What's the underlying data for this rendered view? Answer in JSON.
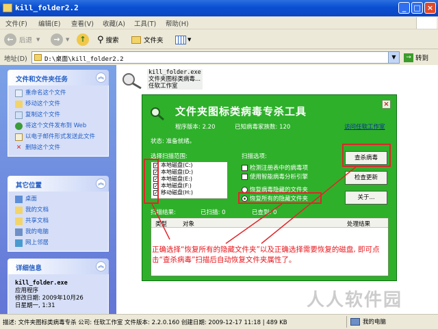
{
  "window": {
    "title": "kill_folder2.2"
  },
  "menu": [
    "文件(F)",
    "编辑(E)",
    "查看(V)",
    "收藏(A)",
    "工具(T)",
    "帮助(H)"
  ],
  "toolbar": {
    "back": "后退",
    "search": "搜索",
    "folders": "文件夹"
  },
  "address": {
    "label": "地址(D)",
    "path": "D:\\桌面\\kill_folder2.2",
    "go": "转到"
  },
  "tasks": {
    "title": "文件和文件夹任务",
    "items": [
      "重命名这个文件",
      "移动这个文件",
      "复制这个文件",
      "将这个文件发布到 Web",
      "以电子邮件形式发送此文件",
      "删除这个文件"
    ]
  },
  "places": {
    "title": "其它位置",
    "items": [
      "桌面",
      "我的文档",
      "共享文档",
      "我的电脑",
      "网上邻居"
    ]
  },
  "details": {
    "title": "详细信息",
    "name": "kill_folder.exe",
    "type": "应用程序",
    "modified_label": "修改日期: 2009年10月26",
    "modified_time": "日星期一, 1:31"
  },
  "file": {
    "name": "kill_folder.exe",
    "desc": "文件夹图标类病毒...",
    "company": "任软工作室"
  },
  "status": {
    "text": "描述: 文件夹图标类病毒专杀 公司: 任软工作室 文件版本: 2.2.0.160 创建日期: 2009-12-17 11:18 | 489 KB",
    "computer": "我的电脑"
  },
  "app": {
    "title": "文件夹图标类病毒专杀工具",
    "version": "程序版本: 2.20",
    "signatures": "已知病毒家族数: 120",
    "link": "访问任软工作室",
    "state": "状态: 准备就绪。",
    "scope_label": "选择扫描范围:",
    "drives": [
      "本地磁盘(C:)",
      "本地磁盘(D:)",
      "本地磁盘(E:)",
      "本地磁盘(F:)",
      "移动磁盘(H:)"
    ],
    "options_label": "扫描选项:",
    "opt1": "检测注册表中的病毒项",
    "opt2": "使用智能病毒分析引擎",
    "opt3": "恢复病毒隐藏的文件夹",
    "opt4": "恢复所有的隐藏文件夹",
    "btn_scan": "查杀病毒",
    "btn_update": "检查更新",
    "btn_about": "关于...",
    "scan_result": "扫描结果:",
    "scanned": "已扫描: 0",
    "detected": "已查到: 0",
    "col_type": "类型",
    "col_object": "对象",
    "col_result": "处理结果"
  },
  "annotation": "正确选择“恢复所有的隐藏文件夹”以及正确选择需要恢复的磁盘, 即可点击“查杀病毒”扫描后自动恢复文件夹属性了。",
  "watermark": "人人软件园"
}
